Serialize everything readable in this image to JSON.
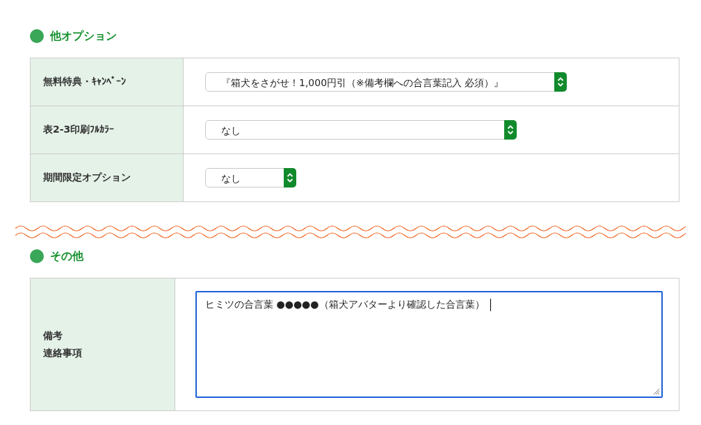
{
  "sections": [
    {
      "kind": "selects",
      "title": "他オプション",
      "rows": [
        {
          "label": "無料特典・ｷｬﾝﾍﾟｰﾝ",
          "value": "『箱犬をさがせ！1,000円引（※備考欄への合言葉記入 必須）』"
        },
        {
          "label": "表2-3印刷ﾌﾙｶﾗｰ",
          "value": "なし"
        },
        {
          "label": "期間限定オプション",
          "value": "なし"
        }
      ]
    },
    {
      "kind": "textarea",
      "title": "その他",
      "rows": [
        {
          "label_lines": [
            "備考",
            "連絡事項"
          ],
          "value": "ヒミツの合言葉 ●●●●●（箱犬アバターより確認した合言葉）",
          "focused": true
        }
      ]
    }
  ]
}
